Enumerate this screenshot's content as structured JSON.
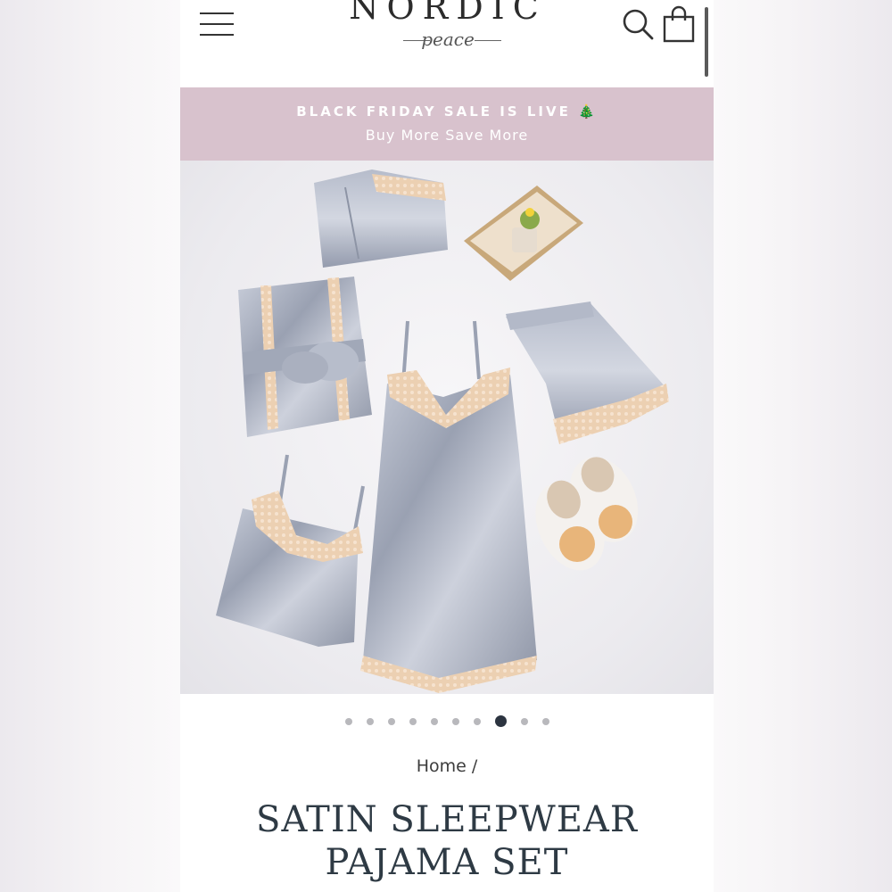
{
  "header": {
    "logo_word": "NORDIC",
    "logo_tagline": "peace",
    "menu_icon": "hamburger-menu-icon",
    "search_icon": "search-icon",
    "cart_icon": "shopping-bag-icon"
  },
  "banner": {
    "title": "BLACK FRIDAY SALE IS LIVE 🎄",
    "subtitle": "Buy More Save More",
    "background_color": "#d8c2cd"
  },
  "gallery": {
    "image_alt": "Satin sleepwear pajama set flat lay",
    "slide_count": 10,
    "active_slide": 8
  },
  "breadcrumb": {
    "home": "Home",
    "separator": "/"
  },
  "product": {
    "title_line1": "SATIN SLEEPWEAR",
    "title_line2": "PAJAMA SET"
  },
  "colors": {
    "accent_dark": "#2e3a44",
    "satin_grey": "#a7adbb",
    "lace_peach": "#e9c9a9"
  }
}
